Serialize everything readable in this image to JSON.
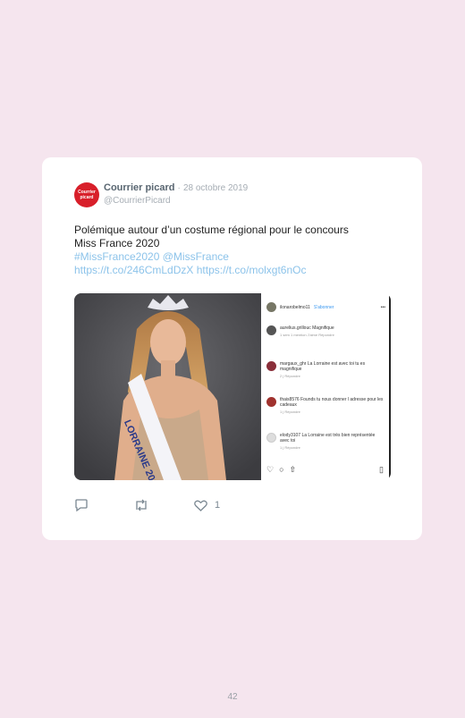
{
  "tweet": {
    "avatar_lines": [
      "Courrier",
      "picard"
    ],
    "author_name": "Courrier picard",
    "separator": "·",
    "date": "28 octobre 2019",
    "handle": "@CourrierPicard",
    "text_line1": "Polémique autour d’un costume régional pour le concours",
    "text_line2": "Miss France 2020",
    "hashtag": "#MissFrance2020",
    "mention": "@MissFrance",
    "link1": "https://t.co/246CmLdDzX",
    "link2": "https://t.co/molxgt6nOc",
    "sash_text": "LORRAINE 2019",
    "likes": "1"
  },
  "instagram": {
    "header_user": "ilonarobelmo11",
    "header_follow": "S'abonner",
    "comments": [
      {
        "user": "aurelius.grillouc",
        "text": "Magnifique",
        "meta": "1 sem   1 mention J'aime   Répondre"
      },
      {
        "user": "margaux_ghr",
        "text": "La Lorraine est avec toi  tu es magnifique",
        "meta": "2 j   Répondre"
      },
      {
        "user": "thais8576",
        "text": "Founds tu nous donner l adresse pour les cadeaux",
        "meta": "1 j   Répondre"
      },
      {
        "user": "elody3107",
        "text": "La Lorraine est très bien représentée avec toi",
        "meta": "1 j   Répondre"
      }
    ]
  },
  "footer": {
    "page_number": "42"
  },
  "colors": {
    "background": "#f5e5ee",
    "link": "#8cc3ea",
    "brand": "#d81f2a"
  }
}
